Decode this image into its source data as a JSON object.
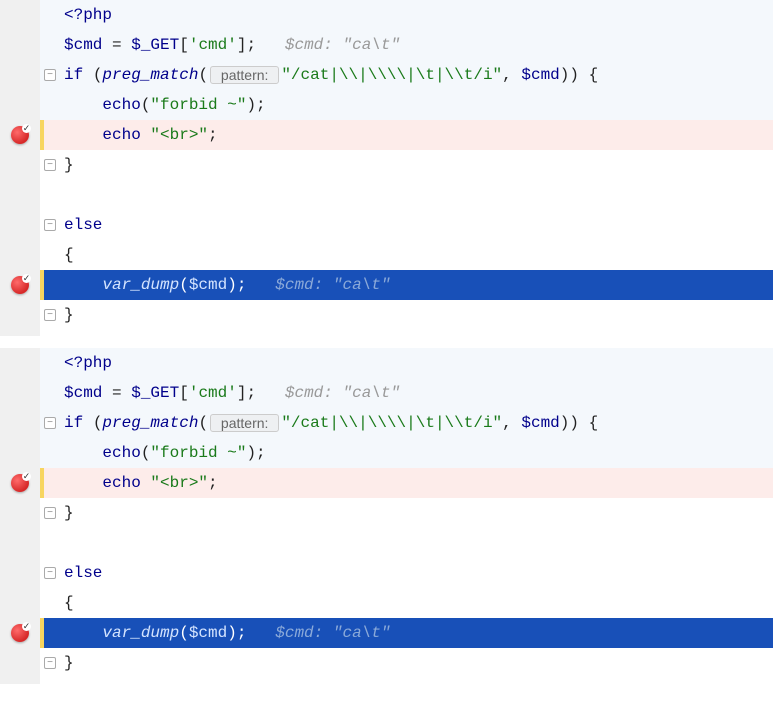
{
  "panels": [
    {
      "lines": [
        {
          "bg": "alt",
          "bp": false,
          "fold": "",
          "cur": false,
          "indent": 0,
          "tokens": [
            [
              "kw",
              "<?php"
            ]
          ]
        },
        {
          "bg": "alt",
          "bp": false,
          "fold": "",
          "cur": false,
          "indent": 0,
          "tokens": [
            [
              "var",
              "$cmd"
            ],
            [
              "pun",
              " = "
            ],
            [
              "var",
              "$_GET"
            ],
            [
              "pun",
              "["
            ],
            [
              "str",
              "'cmd'"
            ],
            [
              "pun",
              "];   "
            ],
            [
              "cmt",
              "$cmd: \"ca\\t\""
            ]
          ]
        },
        {
          "bg": "alt",
          "bp": false,
          "fold": "-",
          "cur": false,
          "indent": 0,
          "tokens": [
            [
              "kw",
              "if "
            ],
            [
              "pun",
              "("
            ],
            [
              "fn",
              "preg_match"
            ],
            [
              "pun",
              "("
            ],
            [
              "hint",
              " pattern: "
            ],
            [
              "str",
              "\"/cat|\\\\|\\\\\\\\|\\t|\\\\t/i\""
            ],
            [
              "pun",
              ", "
            ],
            [
              "var",
              "$cmd"
            ],
            [
              "pun",
              ")) {"
            ]
          ]
        },
        {
          "bg": "alt",
          "bp": false,
          "fold": "",
          "cur": false,
          "indent": 1,
          "tokens": [
            [
              "kw",
              "echo"
            ],
            [
              "pun",
              "("
            ],
            [
              "str",
              "\"forbid ~\""
            ],
            [
              "pun",
              ");"
            ]
          ]
        },
        {
          "bg": "warn",
          "bp": true,
          "fold": "",
          "cur": true,
          "indent": 1,
          "tokens": [
            [
              "kw",
              "echo "
            ],
            [
              "str",
              "\"<br>\""
            ],
            [
              "pun",
              ";"
            ]
          ]
        },
        {
          "bg": "",
          "bp": false,
          "fold": "-",
          "cur": false,
          "indent": 0,
          "tokens": [
            [
              "pun",
              "}"
            ]
          ]
        },
        {
          "bg": "",
          "bp": false,
          "fold": "",
          "cur": false,
          "indent": 0,
          "tokens": []
        },
        {
          "bg": "",
          "bp": false,
          "fold": "-",
          "cur": false,
          "indent": 0,
          "tokens": [
            [
              "kw",
              "else"
            ]
          ]
        },
        {
          "bg": "",
          "bp": false,
          "fold": "",
          "cur": false,
          "indent": 0,
          "tokens": [
            [
              "pun",
              "{"
            ]
          ]
        },
        {
          "bg": "sel",
          "bp": true,
          "fold": "",
          "cur": true,
          "indent": 1,
          "tokens": [
            [
              "sel-fn",
              "var_dump"
            ],
            [
              "sel-pun",
              "("
            ],
            [
              "sel-var",
              "$cmd"
            ],
            [
              "sel-pun",
              ");   "
            ],
            [
              "sel-cmt",
              "$cmd: \"ca\\t\""
            ]
          ]
        },
        {
          "bg": "",
          "bp": false,
          "fold": "-",
          "cur": false,
          "indent": 0,
          "tokens": [
            [
              "pun",
              "}"
            ]
          ]
        }
      ]
    },
    {
      "lines": [
        {
          "bg": "alt",
          "bp": false,
          "fold": "",
          "cur": false,
          "indent": 0,
          "tokens": [
            [
              "kw",
              "<?php"
            ]
          ]
        },
        {
          "bg": "alt",
          "bp": false,
          "fold": "",
          "cur": false,
          "indent": 0,
          "tokens": [
            [
              "var",
              "$cmd"
            ],
            [
              "pun",
              " = "
            ],
            [
              "var",
              "$_GET"
            ],
            [
              "pun",
              "["
            ],
            [
              "str",
              "'cmd'"
            ],
            [
              "pun",
              "];   "
            ],
            [
              "cmt",
              "$cmd: \"ca\\t\""
            ]
          ]
        },
        {
          "bg": "alt",
          "bp": false,
          "fold": "-",
          "cur": false,
          "indent": 0,
          "tokens": [
            [
              "kw",
              "if "
            ],
            [
              "pun",
              "("
            ],
            [
              "fn",
              "preg_match"
            ],
            [
              "pun",
              "("
            ],
            [
              "hint",
              " pattern: "
            ],
            [
              "str",
              "\"/cat|\\\\|\\\\\\\\|\\t|\\\\t/i\""
            ],
            [
              "pun",
              ", "
            ],
            [
              "var",
              "$cmd"
            ],
            [
              "pun",
              ")) {"
            ]
          ]
        },
        {
          "bg": "alt",
          "bp": false,
          "fold": "",
          "cur": false,
          "indent": 1,
          "tokens": [
            [
              "kw",
              "echo"
            ],
            [
              "pun",
              "("
            ],
            [
              "str",
              "\"forbid ~\""
            ],
            [
              "pun",
              ");"
            ]
          ]
        },
        {
          "bg": "warn",
          "bp": true,
          "fold": "",
          "cur": true,
          "indent": 1,
          "tokens": [
            [
              "kw",
              "echo "
            ],
            [
              "str",
              "\"<br>\""
            ],
            [
              "pun",
              ";"
            ]
          ]
        },
        {
          "bg": "",
          "bp": false,
          "fold": "-",
          "cur": false,
          "indent": 0,
          "tokens": [
            [
              "pun",
              "}"
            ]
          ]
        },
        {
          "bg": "",
          "bp": false,
          "fold": "",
          "cur": false,
          "indent": 0,
          "tokens": []
        },
        {
          "bg": "",
          "bp": false,
          "fold": "-",
          "cur": false,
          "indent": 0,
          "tokens": [
            [
              "kw",
              "else"
            ]
          ]
        },
        {
          "bg": "",
          "bp": false,
          "fold": "",
          "cur": false,
          "indent": 0,
          "tokens": [
            [
              "pun",
              "{"
            ]
          ]
        },
        {
          "bg": "sel",
          "bp": true,
          "fold": "",
          "cur": true,
          "indent": 1,
          "tokens": [
            [
              "sel-fn",
              "var_dump"
            ],
            [
              "sel-pun",
              "("
            ],
            [
              "sel-var",
              "$cmd"
            ],
            [
              "sel-pun",
              ");   "
            ],
            [
              "sel-cmt",
              "$cmd: \"ca\\t\""
            ]
          ]
        },
        {
          "bg": "",
          "bp": false,
          "fold": "-",
          "cur": false,
          "indent": 0,
          "tokens": [
            [
              "pun",
              "}"
            ]
          ]
        }
      ]
    }
  ]
}
